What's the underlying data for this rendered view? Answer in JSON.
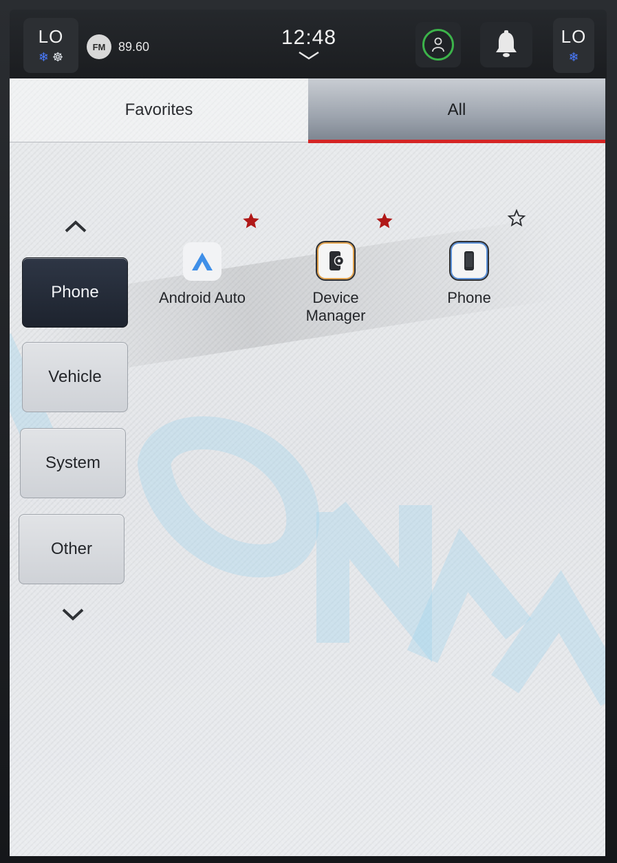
{
  "status_bar": {
    "left_climate": {
      "temp": "LO"
    },
    "right_climate": {
      "temp": "LO"
    },
    "radio": {
      "band": "FM",
      "frequency": "89.60"
    },
    "clock": {
      "time": "12:48"
    }
  },
  "tabs": [
    {
      "label": "Favorites",
      "selected": false
    },
    {
      "label": "All",
      "selected": true
    }
  ],
  "categories": [
    {
      "label": "Phone",
      "selected": true
    },
    {
      "label": "Vehicle",
      "selected": false
    },
    {
      "label": "System",
      "selected": false
    },
    {
      "label": "Other",
      "selected": false
    }
  ],
  "apps": [
    {
      "label": "Android Auto",
      "favorite": true,
      "icon": "android-auto-icon"
    },
    {
      "label": "Device Manager",
      "label_line1": "Device",
      "label_line2": "Manager",
      "favorite": true,
      "icon": "device-manager-icon"
    },
    {
      "label": "Phone",
      "favorite": false,
      "icon": "phone-app-icon"
    }
  ],
  "colors": {
    "accent_red": "#d42424",
    "favorite_star": "#b01818",
    "driver_ring": "#3cb34a",
    "selected_category": "#1d232e",
    "android_auto_blue": "#3f8fe8"
  }
}
